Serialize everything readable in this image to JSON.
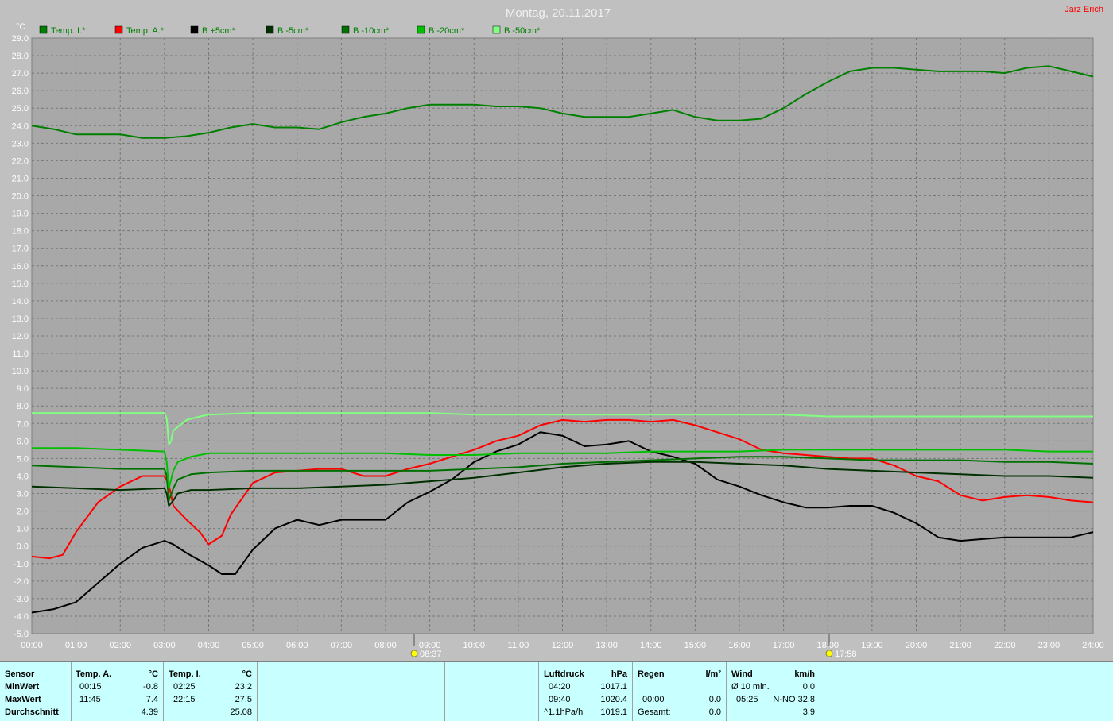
{
  "header": {
    "title": "Montag, 20.11.2017",
    "user": "Jarz Erich",
    "unit_label": "°C"
  },
  "colors": {
    "background": "#c0c0c0",
    "plot_background": "#a8a8a8",
    "grid": "#777777",
    "title": "#f0f0f0",
    "axis_text": "#ffffff",
    "legend_text": "#008000",
    "panel_background": "#c8ffff"
  },
  "sun": {
    "sunrise": "08:37",
    "sunset": "17:58"
  },
  "chart_data": {
    "type": "line",
    "title": "Montag, 20.11.2017",
    "ylabel": "°C",
    "xlim": [
      0,
      24
    ],
    "ylim": [
      -5,
      29
    ],
    "grid": true,
    "legend_position": "top-left",
    "x_ticks": [
      "00:00",
      "01:00",
      "02:00",
      "03:00",
      "04:00",
      "05:00",
      "06:00",
      "07:00",
      "08:00",
      "09:00",
      "10:00",
      "11:00",
      "12:00",
      "13:00",
      "14:00",
      "15:00",
      "16:00",
      "17:00",
      "18:00",
      "19:00",
      "20:00",
      "21:00",
      "22:00",
      "23:00",
      "24:00"
    ],
    "y_ticks": [
      "-5.0",
      "-4.0",
      "-3.0",
      "-2.0",
      "-1.0",
      "0.0",
      "1.0",
      "2.0",
      "3.0",
      "4.0",
      "5.0",
      "6.0",
      "7.0",
      "8.0",
      "9.0",
      "10.0",
      "11.0",
      "12.0",
      "13.0",
      "14.0",
      "15.0",
      "16.0",
      "17.0",
      "18.0",
      "19.0",
      "20.0",
      "21.0",
      "22.0",
      "23.0",
      "24.0",
      "25.0",
      "26.0",
      "27.0",
      "28.0",
      "29.0"
    ],
    "series": [
      {
        "name": "Temp. I.*",
        "color": "#008000",
        "points": [
          [
            0,
            24.0
          ],
          [
            0.5,
            23.8
          ],
          [
            1,
            23.5
          ],
          [
            1.5,
            23.5
          ],
          [
            2,
            23.5
          ],
          [
            2.5,
            23.3
          ],
          [
            3,
            23.3
          ],
          [
            3.5,
            23.4
          ],
          [
            4,
            23.6
          ],
          [
            4.5,
            23.9
          ],
          [
            5,
            24.1
          ],
          [
            5.5,
            23.9
          ],
          [
            6,
            23.9
          ],
          [
            6.5,
            23.8
          ],
          [
            7,
            24.2
          ],
          [
            7.5,
            24.5
          ],
          [
            8,
            24.7
          ],
          [
            8.5,
            25.0
          ],
          [
            9,
            25.2
          ],
          [
            9.5,
            25.2
          ],
          [
            10,
            25.2
          ],
          [
            10.5,
            25.1
          ],
          [
            11,
            25.1
          ],
          [
            11.5,
            25.0
          ],
          [
            12,
            24.7
          ],
          [
            12.5,
            24.5
          ],
          [
            13,
            24.5
          ],
          [
            13.5,
            24.5
          ],
          [
            14,
            24.7
          ],
          [
            14.5,
            24.9
          ],
          [
            15,
            24.5
          ],
          [
            15.5,
            24.3
          ],
          [
            16,
            24.3
          ],
          [
            16.5,
            24.4
          ],
          [
            17,
            25.0
          ],
          [
            17.5,
            25.8
          ],
          [
            18,
            26.5
          ],
          [
            18.5,
            27.1
          ],
          [
            19,
            27.3
          ],
          [
            19.5,
            27.3
          ],
          [
            20,
            27.2
          ],
          [
            20.5,
            27.1
          ],
          [
            21,
            27.1
          ],
          [
            21.5,
            27.1
          ],
          [
            22,
            27.0
          ],
          [
            22.5,
            27.3
          ],
          [
            23,
            27.4
          ],
          [
            23.5,
            27.1
          ],
          [
            24,
            26.8
          ]
        ]
      },
      {
        "name": "Temp. A.*",
        "color": "#ff0000",
        "points": [
          [
            0,
            -0.6
          ],
          [
            0.4,
            -0.7
          ],
          [
            0.7,
            -0.5
          ],
          [
            1,
            0.8
          ],
          [
            1.5,
            2.5
          ],
          [
            2,
            3.4
          ],
          [
            2.5,
            4.0
          ],
          [
            3,
            4.0
          ],
          [
            3.1,
            3.5
          ],
          [
            3.2,
            2.3
          ],
          [
            3.5,
            1.5
          ],
          [
            3.8,
            0.8
          ],
          [
            4,
            0.1
          ],
          [
            4.3,
            0.6
          ],
          [
            4.5,
            1.8
          ],
          [
            5,
            3.6
          ],
          [
            5.5,
            4.2
          ],
          [
            6,
            4.3
          ],
          [
            6.5,
            4.4
          ],
          [
            7,
            4.4
          ],
          [
            7.5,
            4.0
          ],
          [
            8,
            4.0
          ],
          [
            8.5,
            4.4
          ],
          [
            9,
            4.7
          ],
          [
            9.5,
            5.1
          ],
          [
            10,
            5.5
          ],
          [
            10.5,
            6.0
          ],
          [
            11,
            6.3
          ],
          [
            11.5,
            6.9
          ],
          [
            12,
            7.2
          ],
          [
            12.5,
            7.1
          ],
          [
            13,
            7.2
          ],
          [
            13.5,
            7.2
          ],
          [
            14,
            7.1
          ],
          [
            14.5,
            7.2
          ],
          [
            15,
            6.9
          ],
          [
            15.5,
            6.5
          ],
          [
            16,
            6.1
          ],
          [
            16.5,
            5.5
          ],
          [
            17,
            5.3
          ],
          [
            17.5,
            5.2
          ],
          [
            18,
            5.1
          ],
          [
            18.5,
            5.0
          ],
          [
            19,
            5.0
          ],
          [
            19.5,
            4.6
          ],
          [
            20,
            4.0
          ],
          [
            20.5,
            3.7
          ],
          [
            21,
            2.9
          ],
          [
            21.5,
            2.6
          ],
          [
            22,
            2.8
          ],
          [
            22.5,
            2.9
          ],
          [
            23,
            2.8
          ],
          [
            23.5,
            2.6
          ],
          [
            24,
            2.5
          ]
        ]
      },
      {
        "name": "B +5cm*",
        "color": "#000000",
        "points": [
          [
            0,
            -3.8
          ],
          [
            0.5,
            -3.6
          ],
          [
            1,
            -3.2
          ],
          [
            1.5,
            -2.1
          ],
          [
            2,
            -1.0
          ],
          [
            2.5,
            -0.1
          ],
          [
            3,
            0.3
          ],
          [
            3.2,
            0.1
          ],
          [
            3.5,
            -0.4
          ],
          [
            4,
            -1.1
          ],
          [
            4.3,
            -1.6
          ],
          [
            4.6,
            -1.6
          ],
          [
            5,
            -0.2
          ],
          [
            5.5,
            1.0
          ],
          [
            6,
            1.5
          ],
          [
            6.5,
            1.2
          ],
          [
            7,
            1.5
          ],
          [
            7.5,
            1.5
          ],
          [
            8,
            1.5
          ],
          [
            8.5,
            2.5
          ],
          [
            9,
            3.1
          ],
          [
            9.5,
            3.8
          ],
          [
            10,
            4.8
          ],
          [
            10.5,
            5.4
          ],
          [
            11,
            5.8
          ],
          [
            11.5,
            6.5
          ],
          [
            12,
            6.3
          ],
          [
            12.5,
            5.7
          ],
          [
            13,
            5.8
          ],
          [
            13.5,
            6.0
          ],
          [
            14,
            5.4
          ],
          [
            14.5,
            5.1
          ],
          [
            15,
            4.7
          ],
          [
            15.5,
            3.8
          ],
          [
            16,
            3.4
          ],
          [
            16.5,
            2.9
          ],
          [
            17,
            2.5
          ],
          [
            17.5,
            2.2
          ],
          [
            18,
            2.2
          ],
          [
            18.5,
            2.3
          ],
          [
            19,
            2.3
          ],
          [
            19.5,
            1.9
          ],
          [
            20,
            1.3
          ],
          [
            20.5,
            0.5
          ],
          [
            21,
            0.3
          ],
          [
            21.5,
            0.4
          ],
          [
            22,
            0.5
          ],
          [
            22.5,
            0.5
          ],
          [
            23,
            0.5
          ],
          [
            23.5,
            0.5
          ],
          [
            24,
            0.8
          ]
        ]
      },
      {
        "name": "B -5cm*",
        "color": "#003000",
        "points": [
          [
            0,
            3.4
          ],
          [
            1,
            3.3
          ],
          [
            2,
            3.2
          ],
          [
            3,
            3.3
          ],
          [
            3.05,
            3.0
          ],
          [
            3.1,
            2.3
          ],
          [
            3.2,
            2.6
          ],
          [
            3.3,
            3.0
          ],
          [
            3.6,
            3.2
          ],
          [
            4,
            3.2
          ],
          [
            5,
            3.3
          ],
          [
            6,
            3.3
          ],
          [
            7,
            3.4
          ],
          [
            8,
            3.5
          ],
          [
            9,
            3.7
          ],
          [
            10,
            3.9
          ],
          [
            11,
            4.2
          ],
          [
            12,
            4.5
          ],
          [
            13,
            4.7
          ],
          [
            14,
            4.8
          ],
          [
            15,
            4.8
          ],
          [
            16,
            4.7
          ],
          [
            17,
            4.6
          ],
          [
            18,
            4.4
          ],
          [
            19,
            4.3
          ],
          [
            20,
            4.2
          ],
          [
            21,
            4.1
          ],
          [
            22,
            4.0
          ],
          [
            23,
            4.0
          ],
          [
            24,
            3.9
          ]
        ]
      },
      {
        "name": "B -10cm*",
        "color": "#007000",
        "points": [
          [
            0,
            4.6
          ],
          [
            1,
            4.5
          ],
          [
            2,
            4.4
          ],
          [
            3,
            4.4
          ],
          [
            3.05,
            4.0
          ],
          [
            3.1,
            2.6
          ],
          [
            3.2,
            3.3
          ],
          [
            3.3,
            3.8
          ],
          [
            3.6,
            4.1
          ],
          [
            4,
            4.2
          ],
          [
            5,
            4.3
          ],
          [
            6,
            4.3
          ],
          [
            7,
            4.3
          ],
          [
            8,
            4.3
          ],
          [
            9,
            4.3
          ],
          [
            10,
            4.4
          ],
          [
            11,
            4.5
          ],
          [
            12,
            4.7
          ],
          [
            13,
            4.8
          ],
          [
            14,
            4.9
          ],
          [
            15,
            5.0
          ],
          [
            16,
            5.1
          ],
          [
            17,
            5.1
          ],
          [
            18,
            5.0
          ],
          [
            19,
            4.9
          ],
          [
            20,
            4.9
          ],
          [
            21,
            4.9
          ],
          [
            22,
            4.8
          ],
          [
            23,
            4.8
          ],
          [
            24,
            4.7
          ]
        ]
      },
      {
        "name": "B -20cm*",
        "color": "#00c000",
        "points": [
          [
            0,
            5.6
          ],
          [
            1,
            5.6
          ],
          [
            2,
            5.5
          ],
          [
            3,
            5.4
          ],
          [
            3.05,
            4.8
          ],
          [
            3.1,
            3.3
          ],
          [
            3.2,
            4.3
          ],
          [
            3.3,
            4.8
          ],
          [
            3.6,
            5.1
          ],
          [
            4,
            5.3
          ],
          [
            5,
            5.3
          ],
          [
            6,
            5.3
          ],
          [
            7,
            5.3
          ],
          [
            8,
            5.3
          ],
          [
            9,
            5.2
          ],
          [
            10,
            5.2
          ],
          [
            11,
            5.3
          ],
          [
            12,
            5.3
          ],
          [
            13,
            5.3
          ],
          [
            14,
            5.4
          ],
          [
            15,
            5.4
          ],
          [
            16,
            5.4
          ],
          [
            17,
            5.5
          ],
          [
            18,
            5.5
          ],
          [
            19,
            5.5
          ],
          [
            20,
            5.5
          ],
          [
            21,
            5.5
          ],
          [
            22,
            5.5
          ],
          [
            23,
            5.4
          ],
          [
            24,
            5.4
          ]
        ]
      },
      {
        "name": "B -50cm*",
        "color": "#80ff80",
        "points": [
          [
            0,
            7.6
          ],
          [
            1,
            7.6
          ],
          [
            2,
            7.6
          ],
          [
            3,
            7.6
          ],
          [
            3.05,
            7.3
          ],
          [
            3.1,
            5.8
          ],
          [
            3.15,
            6.0
          ],
          [
            3.2,
            6.6
          ],
          [
            3.3,
            6.8
          ],
          [
            3.5,
            7.2
          ],
          [
            3.8,
            7.4
          ],
          [
            4,
            7.5
          ],
          [
            5,
            7.6
          ],
          [
            6,
            7.6
          ],
          [
            7,
            7.6
          ],
          [
            8,
            7.6
          ],
          [
            9,
            7.6
          ],
          [
            10,
            7.5
          ],
          [
            11,
            7.5
          ],
          [
            12,
            7.5
          ],
          [
            13,
            7.5
          ],
          [
            14,
            7.5
          ],
          [
            15,
            7.5
          ],
          [
            16,
            7.5
          ],
          [
            17,
            7.5
          ],
          [
            18,
            7.4
          ],
          [
            19,
            7.4
          ],
          [
            20,
            7.4
          ],
          [
            21,
            7.4
          ],
          [
            22,
            7.4
          ],
          [
            23,
            7.4
          ],
          [
            24,
            7.4
          ]
        ]
      }
    ]
  },
  "stats": {
    "sensor": {
      "label": "Sensor",
      "rows": [
        "MinWert",
        "MaxWert",
        "Durchschnitt"
      ]
    },
    "temp_a": {
      "label": "Temp. A.",
      "unit": "°C",
      "min_time": "00:15",
      "min": "-0.8",
      "max_time": "11:45",
      "max": "7.4",
      "avg": "4.39"
    },
    "temp_i": {
      "label": "Temp. I.",
      "unit": "°C",
      "min_time": "02:25",
      "min": "23.2",
      "max_time": "22:15",
      "max": "27.5",
      "avg": "25.08"
    },
    "pressure": {
      "label": "Luftdruck",
      "unit": "hPa",
      "min_time": "04:20",
      "min": "1017.1",
      "max_time": "09:40",
      "max": "1020.4",
      "trend": "^1.1hPa/h",
      "current": "1019.1"
    },
    "rain": {
      "label": "Regen",
      "unit": "l/m²",
      "r2_time": "00:00",
      "r2_val": "0.0",
      "total_label": "Gesamt:",
      "total": "0.0"
    },
    "wind": {
      "label": "Wind",
      "unit": "km/h",
      "avg_label": "Ø 10 min.",
      "avg": "0.0",
      "max_time": "05:25",
      "max": "N-NO 32.8",
      "r3": "3.9"
    }
  }
}
